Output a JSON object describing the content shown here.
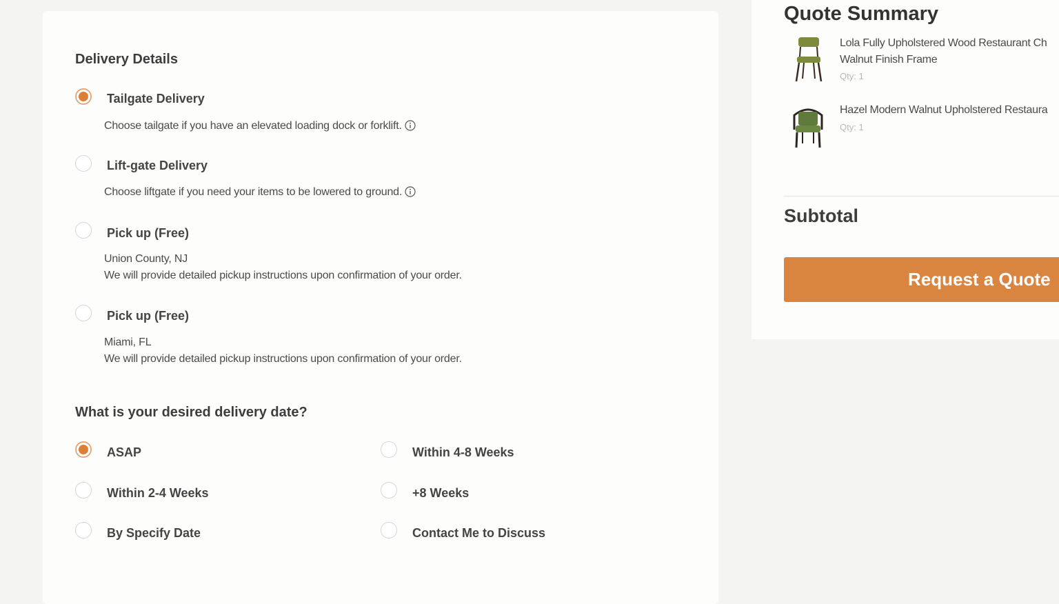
{
  "delivery": {
    "title": "Delivery Details",
    "options": [
      {
        "label": "Tailgate Delivery",
        "desc": "Choose tailgate if you have an elevated loading dock or forklift.",
        "selected": true
      },
      {
        "label": "Lift-gate Delivery",
        "desc": "Choose liftgate if you need your items to be lowered to ground.",
        "selected": false
      },
      {
        "label": "Pick up (Free)",
        "location": "Union County, NJ",
        "desc": "We will provide detailed pickup instructions upon confirmation of your order.",
        "selected": false
      },
      {
        "label": "Pick up (Free)",
        "location": "Miami, FL",
        "desc": "We will provide detailed pickup instructions upon confirmation of your order.",
        "selected": false
      }
    ]
  },
  "date": {
    "title": "What is your desired delivery date?",
    "options": [
      {
        "label": "ASAP",
        "selected": true
      },
      {
        "label": "Within 4-8 Weeks",
        "selected": false
      },
      {
        "label": "Within 2-4 Weeks",
        "selected": false
      },
      {
        "label": "+8 Weeks",
        "selected": false
      },
      {
        "label": "By Specify Date",
        "selected": false
      },
      {
        "label": "Contact Me to Discuss",
        "selected": false
      }
    ]
  },
  "summary": {
    "title": "Quote Summary",
    "items": [
      {
        "name_line1": "Lola Fully Upholstered Wood Restaurant Ch",
        "name_line2": "Walnut Finish Frame",
        "qty": "Qty: 1",
        "icon": "chair-icon"
      },
      {
        "name_line1": "Hazel Modern Walnut Upholstered Restaura",
        "qty": "Qty: 1",
        "icon": "armchair-icon"
      }
    ],
    "subtotal_label": "Subtotal",
    "button_label": "Request a Quote"
  },
  "colors": {
    "accent": "#dc7f39",
    "button": "#d9843f",
    "upholstery": "#7d8c3c"
  }
}
